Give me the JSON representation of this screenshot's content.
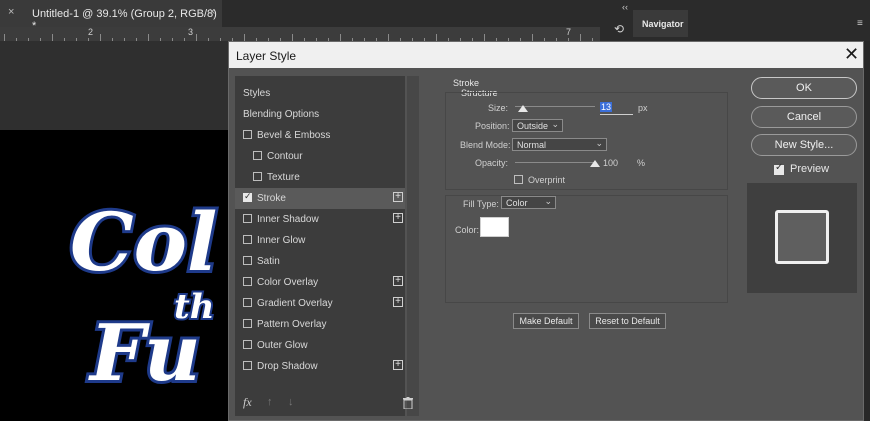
{
  "app": {
    "doc_tab": "Untitled-1 @ 39.1% (Group 2, RGB/8) *",
    "panel_tab": "Navigator",
    "ruler_numbers": [
      "2",
      "3",
      "7"
    ]
  },
  "canvas_text": [
    "Col",
    "th",
    "Fu"
  ],
  "dialog": {
    "title": "Layer Style",
    "close": "✕",
    "styles_header": "Styles",
    "blending_options": "Blending Options",
    "items": [
      {
        "label": "Bevel & Emboss",
        "checked": false,
        "plus": false
      },
      {
        "label": "Contour",
        "checked": false,
        "plus": false,
        "indent": true
      },
      {
        "label": "Texture",
        "checked": false,
        "plus": false,
        "indent": true
      },
      {
        "label": "Stroke",
        "checked": true,
        "plus": true,
        "selected": true
      },
      {
        "label": "Inner Shadow",
        "checked": false,
        "plus": true
      },
      {
        "label": "Inner Glow",
        "checked": false,
        "plus": false
      },
      {
        "label": "Satin",
        "checked": false,
        "plus": false
      },
      {
        "label": "Color Overlay",
        "checked": false,
        "plus": true
      },
      {
        "label": "Gradient Overlay",
        "checked": false,
        "plus": true
      },
      {
        "label": "Pattern Overlay",
        "checked": false,
        "plus": false
      },
      {
        "label": "Outer Glow",
        "checked": false,
        "plus": false
      },
      {
        "label": "Drop Shadow",
        "checked": false,
        "plus": true
      }
    ],
    "footer": {
      "fx": "fx",
      "up": "↑",
      "down": "↓",
      "trash": "trash-icon"
    },
    "stroke": {
      "section": "Stroke",
      "structure": "Structure",
      "size_label": "Size:",
      "size_value": "13",
      "size_unit": "px",
      "size_fraction": 0.1,
      "position_label": "Position:",
      "position_value": "Outside",
      "blend_label": "Blend Mode:",
      "blend_value": "Normal",
      "opacity_label": "Opacity:",
      "opacity_value": "100",
      "opacity_unit": "%",
      "opacity_fraction": 1.0,
      "overprint_label": "Overprint",
      "fill_type_label": "Fill Type:",
      "fill_type_value": "Color",
      "color_label": "Color:",
      "color_value": "#ffffff",
      "make_default": "Make Default",
      "reset_default": "Reset to Default"
    },
    "buttons": {
      "ok": "OK",
      "cancel": "Cancel",
      "new_style": "New Style..."
    },
    "preview_label": "Preview"
  }
}
